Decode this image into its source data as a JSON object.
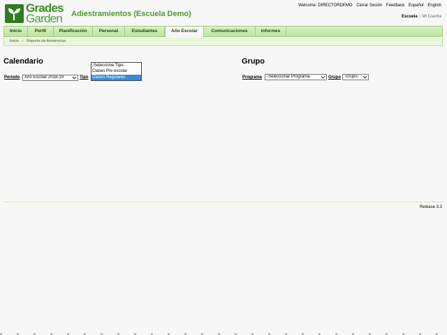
{
  "brand": {
    "logo_line1": "Grades",
    "logo_line2": "Garden",
    "app_title": "Adiestramientos (Escuela Demo)"
  },
  "top_links": {
    "welcome": "Welcome: DIRECTORDEMO",
    "logout": "Cerrar Sesión",
    "feedback": "Feedback",
    "spanish": "Español",
    "english": "English"
  },
  "sub_links": {
    "escuela": "Escuela",
    "separator": "|",
    "mi_cuenta": "Mi Cuenta"
  },
  "nav": {
    "items": [
      {
        "label": "Inicio"
      },
      {
        "label": "Perfil"
      },
      {
        "label": "Planificación"
      },
      {
        "label": "Personal"
      },
      {
        "label": "Estudiantes"
      },
      {
        "label": "Año Escolar"
      },
      {
        "label": "Comunicaciones"
      },
      {
        "label": "Informes"
      }
    ],
    "active": "Año Escolar"
  },
  "breadcrumb": {
    "home": "Inicio",
    "separator": ">",
    "current": "Reporte de Asistencias"
  },
  "calendario": {
    "title": "Calendario",
    "periodo_label": "Periodo",
    "periodo_value": "Año Escolar 2018-19",
    "tipo_label": "Tipo",
    "tipo_options": [
      "-Seleccione Tipo-",
      "Clases Pre escolar",
      "Clases Regulares"
    ],
    "tipo_selected": "Clases Regulares"
  },
  "grupo": {
    "title": "Grupo",
    "programa_label": "Programa",
    "programa_value": "-Seleccionar Programa-",
    "grupo_label": "Grupo",
    "grupo_value": "-Grupo-"
  },
  "footer": {
    "release": "Release 3.3"
  },
  "colors": {
    "brand_green": "#3b8d25",
    "nav_bg": "#bfe3a2",
    "selection_blue": "#3b8ad8"
  }
}
